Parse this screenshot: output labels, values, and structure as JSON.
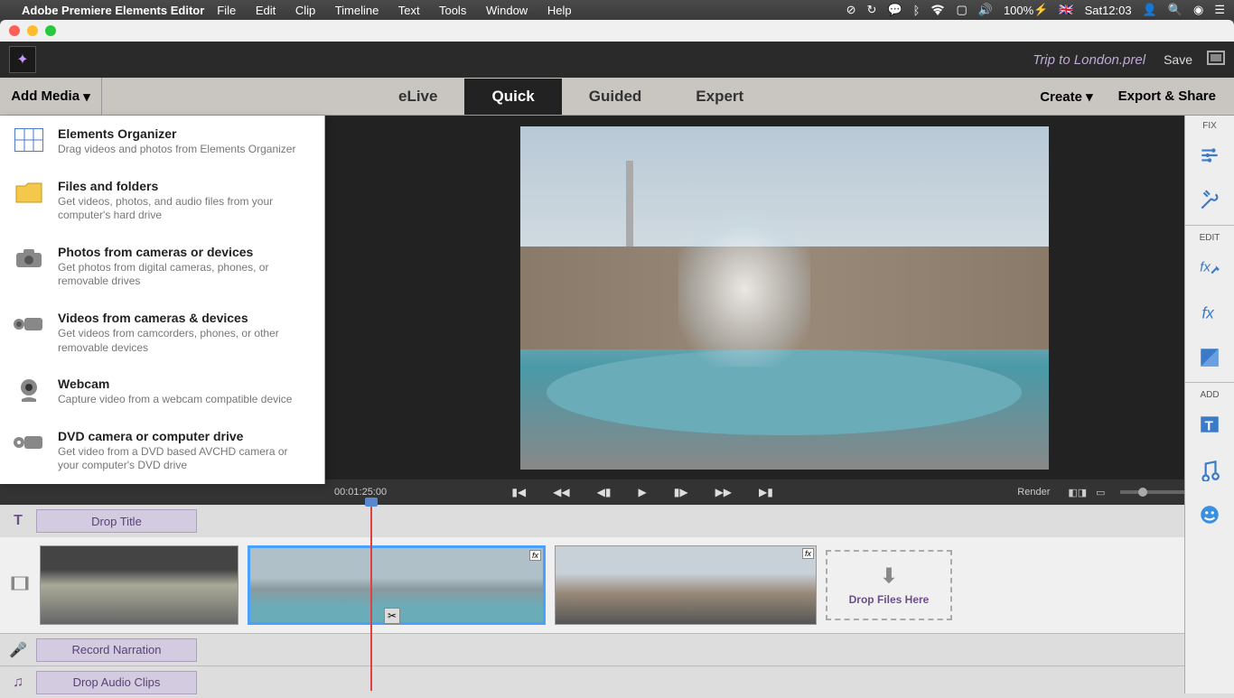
{
  "menubar": {
    "app_name": "Adobe Premiere Elements Editor",
    "menus": [
      "File",
      "Edit",
      "Clip",
      "Timeline",
      "Text",
      "Tools",
      "Window",
      "Help"
    ],
    "status": {
      "battery": "100%",
      "flag": "🇬🇧",
      "day": "Sat",
      "time": "12:03"
    }
  },
  "titlebar": {
    "doc_title": "Trip to London.prel",
    "save": "Save"
  },
  "modebar": {
    "add_media": "Add Media",
    "tabs": {
      "elive": "eLive",
      "quick": "Quick",
      "guided": "Guided",
      "expert": "Expert"
    },
    "create": "Create",
    "export": "Export & Share"
  },
  "add_media_panel": [
    {
      "title": "Elements Organizer",
      "desc": "Drag videos and photos from Elements Organizer"
    },
    {
      "title": "Files and folders",
      "desc": "Get videos, photos, and audio files from your computer's hard drive"
    },
    {
      "title": "Photos from cameras or devices",
      "desc": "Get photos from digital cameras, phones, or removable drives"
    },
    {
      "title": "Videos from cameras & devices",
      "desc": "Get videos from camcorders, phones, or other removable devices"
    },
    {
      "title": "Webcam",
      "desc": "Capture video from a webcam compatible device"
    },
    {
      "title": "DVD camera or computer drive",
      "desc": "Get video from a DVD based AVCHD camera or your computer's DVD drive"
    }
  ],
  "playback": {
    "timecode": "00:01:25:00",
    "render": "Render"
  },
  "timeline": {
    "title_track": "Drop Title",
    "narration": "Record Narration",
    "audio": "Drop Audio Clips",
    "drop_zone": "Drop Files Here"
  },
  "rail": {
    "fix": "FIX",
    "edit": "EDIT",
    "add": "ADD"
  }
}
